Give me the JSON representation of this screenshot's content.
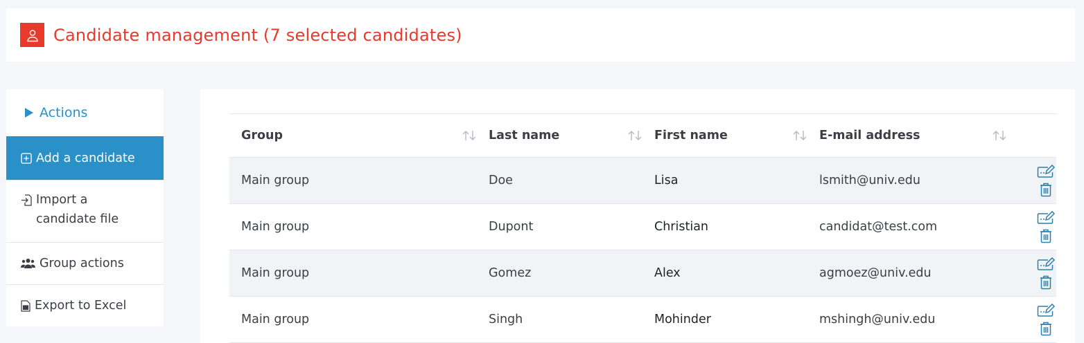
{
  "header": {
    "title": "Candidate management (7 selected candidates)",
    "icon": "user-icon",
    "accent_color": "#e8392b"
  },
  "sidebar": {
    "heading": "Actions",
    "heading_icon": "play-icon",
    "items": [
      {
        "label": "Add a candidate",
        "icon": "plus-square-icon",
        "active": true
      },
      {
        "label": "Import a candidate file",
        "icon": "import-icon",
        "active": false
      },
      {
        "label": "Group actions",
        "icon": "users-icon",
        "active": false
      },
      {
        "label": "Export to Excel",
        "icon": "excel-file-icon",
        "active": false
      }
    ],
    "accent_color": "#2a90c8"
  },
  "table": {
    "columns": [
      "Group",
      "Last name",
      "First name",
      "E-mail address"
    ],
    "rows": [
      {
        "group": "Main group",
        "last": "Doe",
        "first": "Lisa",
        "email": "lsmith@univ.edu"
      },
      {
        "group": "Main group",
        "last": "Dupont",
        "first": "Christian",
        "email": "candidat@test.com"
      },
      {
        "group": "Main group",
        "last": "Gomez",
        "first": "Alex",
        "email": "agmoez@univ.edu"
      },
      {
        "group": "Main group",
        "last": "Singh",
        "first": "Mohinder",
        "email": "mshingh@univ.edu"
      }
    ],
    "row_actions": [
      "edit-icon",
      "trash-icon"
    ]
  }
}
